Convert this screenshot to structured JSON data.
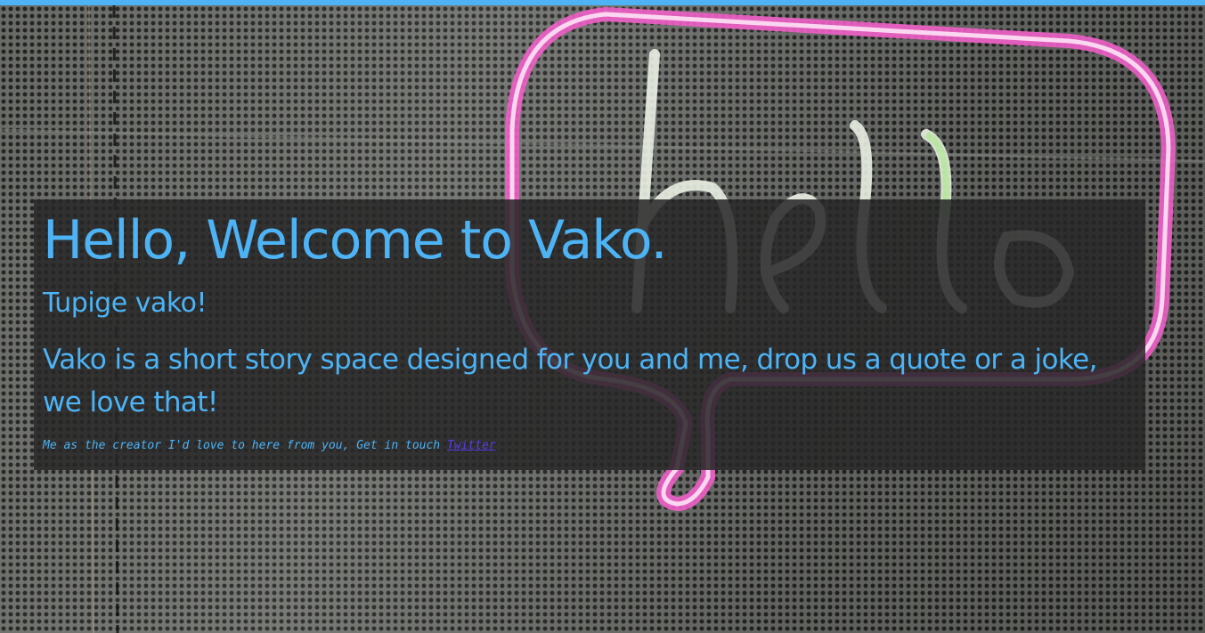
{
  "page": {
    "accent_color": "#4db3f5",
    "link_color": "#5b3ce6",
    "background_image": "neon-hello-sign"
  },
  "hero": {
    "title": "Hello, Welcome to Vako.",
    "subtitle": "Tupige vako!",
    "description": "Vako is a short story space designed for you and me, drop us a quote or a joke, we love that!",
    "contact_text": "Me as the creator I'd love to here from you, Get in touch ",
    "contact_link_label": "Twitter"
  }
}
